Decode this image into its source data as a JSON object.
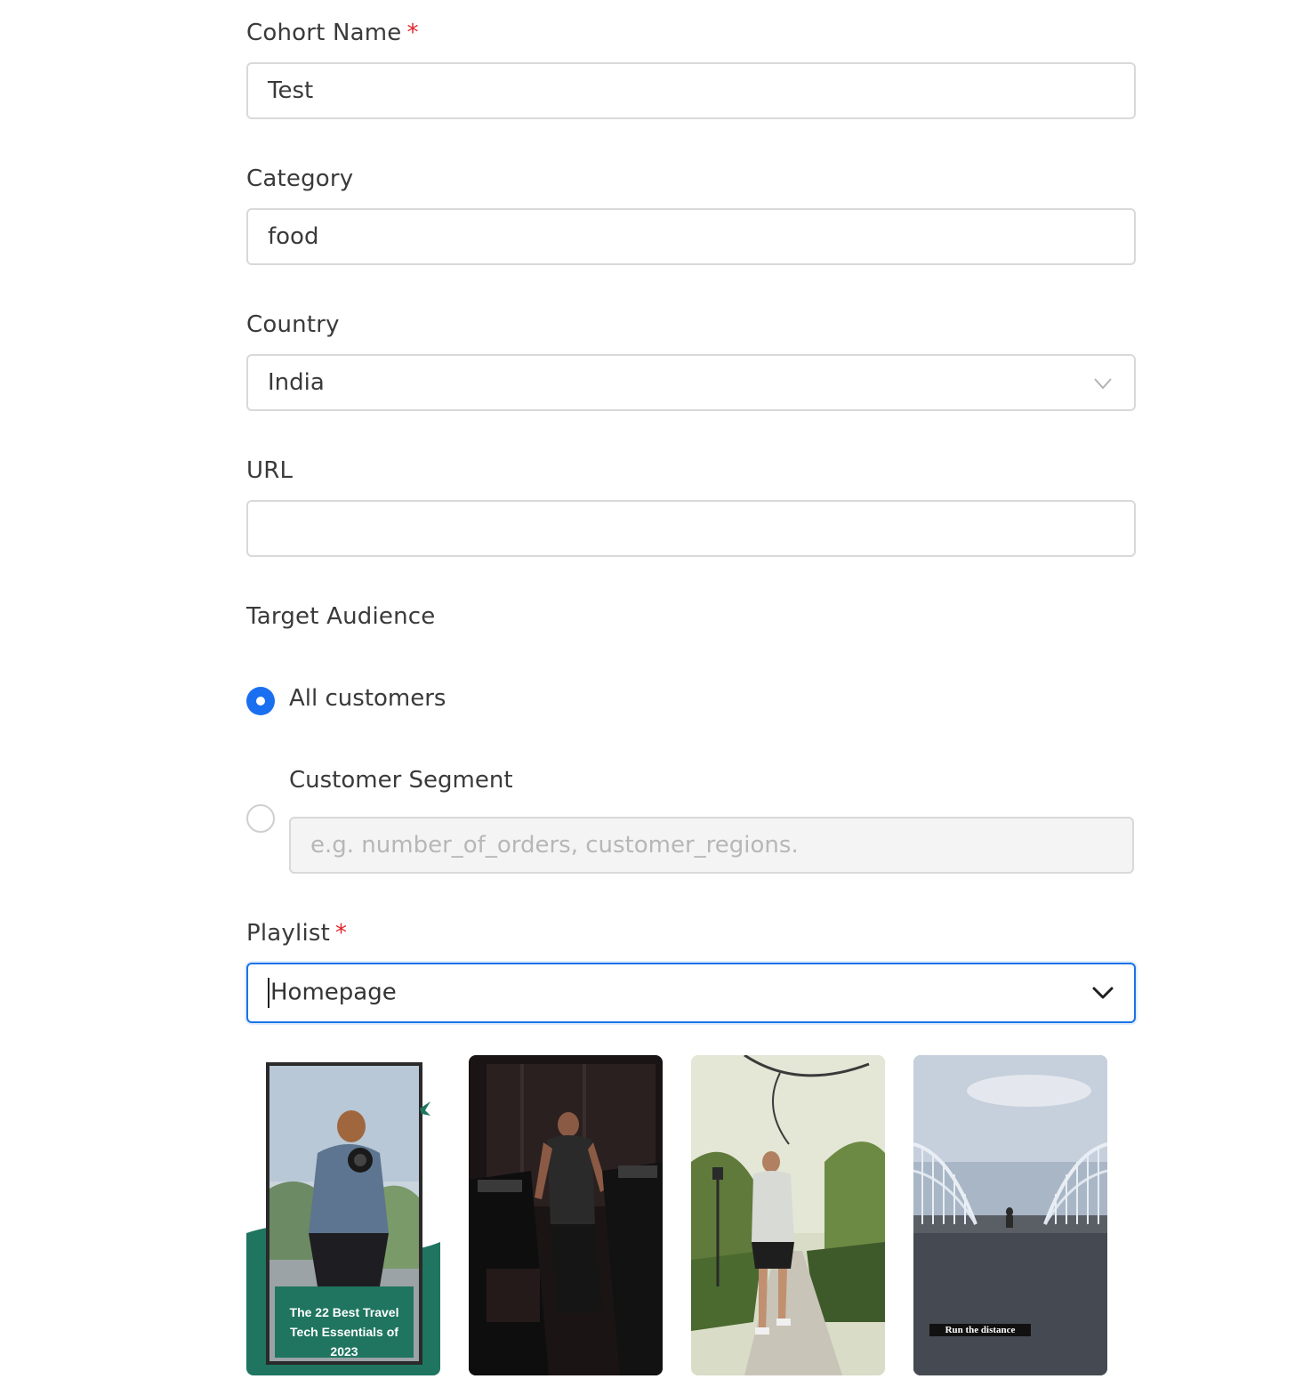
{
  "cohort_name": {
    "label": "Cohort Name",
    "required_mark": "*",
    "value": "Test"
  },
  "category": {
    "label": "Category",
    "value": "food"
  },
  "country": {
    "label": "Country",
    "value": "India"
  },
  "url": {
    "label": "URL",
    "value": ""
  },
  "target_audience": {
    "label": "Target Audience",
    "options": [
      {
        "label": "All customers",
        "checked": true
      },
      {
        "label": "Customer Segment",
        "checked": false,
        "placeholder": "e.g. number_of_orders, customer_regions."
      }
    ]
  },
  "playlist": {
    "label": "Playlist",
    "required_mark": "*",
    "value": "Homepage",
    "videos": [
      {
        "name": "travel-tech-thumbnail",
        "caption": "The 22 Best Travel Tech Essentials of 2023"
      },
      {
        "name": "treadmill-workout-thumbnail",
        "caption": ""
      },
      {
        "name": "park-jogger-thumbnail",
        "caption": ""
      },
      {
        "name": "bridge-runner-thumbnail",
        "caption": "Run the distance"
      }
    ]
  },
  "colors": {
    "accent": "#1a6ff0",
    "required": "#e0242b",
    "border": "#d9d9d9"
  }
}
